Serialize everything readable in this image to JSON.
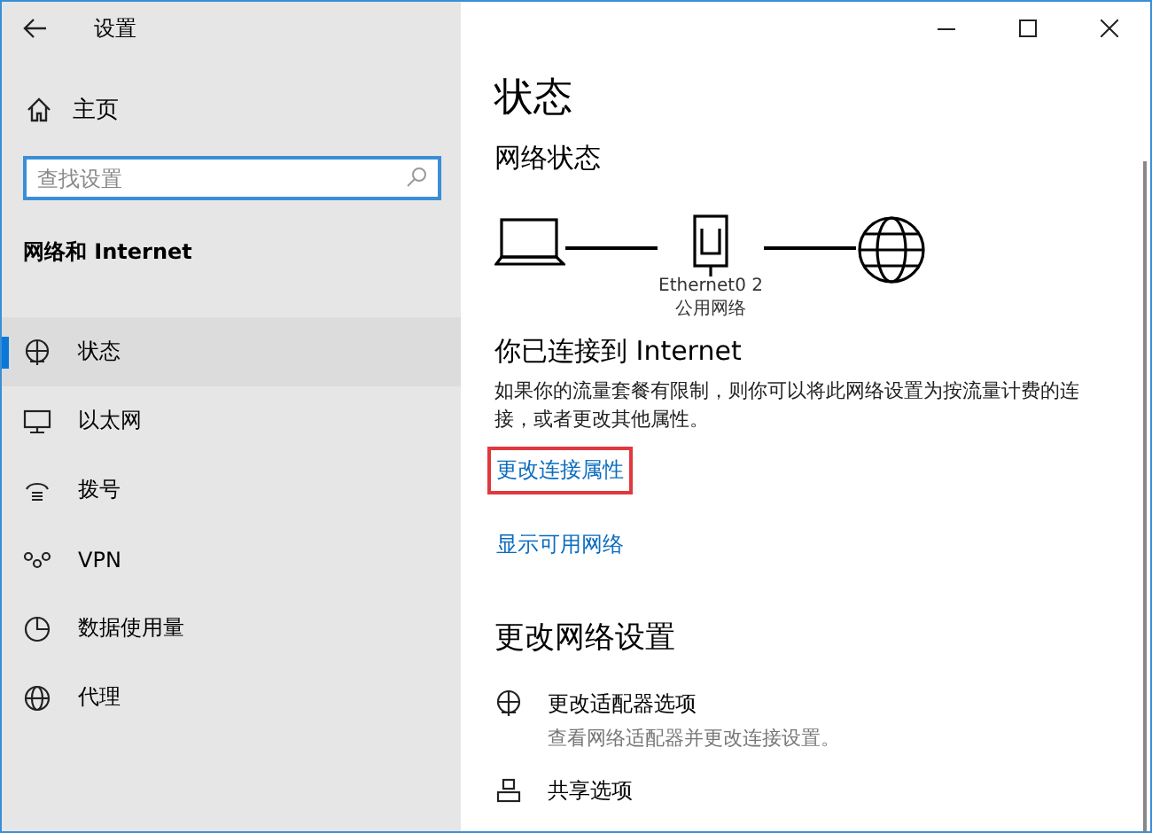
{
  "window": {
    "title": "设置"
  },
  "sidebar": {
    "home": "主页",
    "search": {
      "placeholder": "查找设置"
    },
    "section": "网络和 Internet",
    "items": [
      {
        "kind": "status",
        "label": "状态",
        "selected": true
      },
      {
        "kind": "ethernet",
        "label": "以太网",
        "selected": false
      },
      {
        "kind": "dialup",
        "label": "拨号",
        "selected": false
      },
      {
        "kind": "vpn",
        "label": "VPN",
        "selected": false
      },
      {
        "kind": "data",
        "label": "数据使用量",
        "selected": false
      },
      {
        "kind": "proxy",
        "label": "代理",
        "selected": false
      }
    ]
  },
  "main": {
    "title": "状态",
    "network_status": {
      "heading": "网络状态",
      "adapter": "Ethernet0 2",
      "network": "公用网络"
    },
    "connected": "你已连接到 Internet",
    "description": "如果你的流量套餐有限制，则你可以将此网络设置为按流量计费的连接，或者更改其他属性。",
    "links": [
      {
        "label": "更改连接属性",
        "highlighted": true
      },
      {
        "label": "显示可用网络",
        "highlighted": false
      }
    ],
    "settings_heading": "更改网络设置",
    "options": [
      {
        "kind": "adapter",
        "title": "更改适配器选项",
        "subtitle": "查看网络适配器并更改连接设置。"
      },
      {
        "kind": "sharing",
        "title": "共享选项"
      }
    ]
  }
}
